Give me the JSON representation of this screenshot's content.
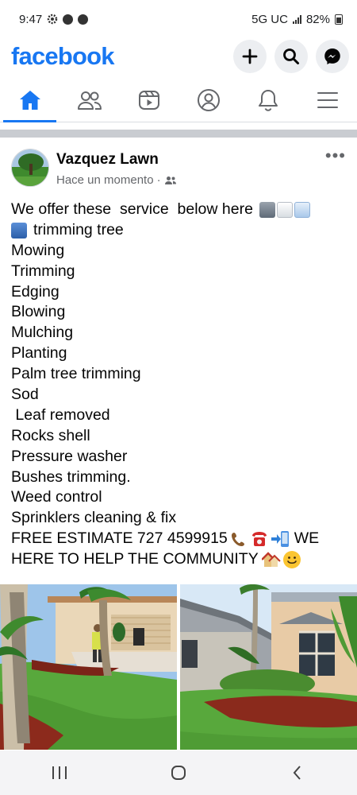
{
  "status_bar": {
    "time": "9:47",
    "network": "5G UC",
    "battery": "82%"
  },
  "header": {
    "logo": "facebook",
    "icons": [
      "plus-icon",
      "search-icon",
      "messenger-icon"
    ]
  },
  "nav": {
    "items": [
      {
        "name": "home",
        "icon": "home-icon",
        "active": true
      },
      {
        "name": "friends",
        "icon": "friends-icon",
        "active": false
      },
      {
        "name": "video",
        "icon": "video-icon",
        "active": false
      },
      {
        "name": "profile",
        "icon": "profile-icon",
        "active": false
      },
      {
        "name": "notifications",
        "icon": "bell-icon",
        "active": false
      },
      {
        "name": "menu",
        "icon": "hamburger-icon",
        "active": false
      }
    ]
  },
  "post": {
    "author": "Vazquez Lawn",
    "timestamp": "Hace un momento",
    "meta_separator": "·",
    "more": "•••",
    "lines": [
      "We offer these  service  below here",
      "trimming tree",
      "Mowing",
      "Trimming",
      "Edging",
      "Blowing",
      "Mulching",
      "Planting",
      "Palm tree trimming",
      "Sod",
      " Leaf removed",
      "Rocks shell",
      "Pressure washer",
      "Bushes trimming.",
      "Weed control",
      "Sprinklers cleaning & fix",
      "FREE ESTIMATE 727 4599915",
      "HERE TO HELP THE COMMUNITY"
    ],
    "line17_tail": "WE"
  },
  "colors": {
    "brand": "#1877f2",
    "text": "#050505",
    "muted": "#65676b",
    "separator": "#c9ccd1"
  },
  "android_nav": [
    "recents-icon",
    "home-circle-icon",
    "back-icon"
  ]
}
